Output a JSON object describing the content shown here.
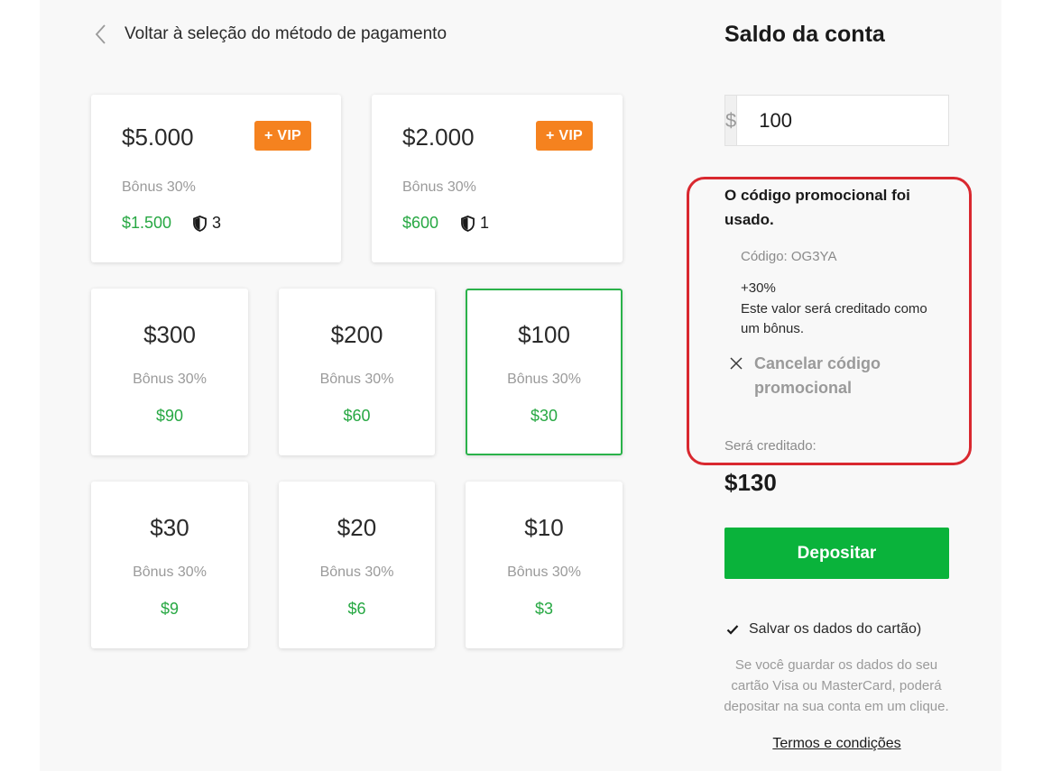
{
  "back_link": {
    "label": "Voltar à seleção do método de pagamento"
  },
  "packages_big": [
    {
      "amount": "$5.000",
      "vip_label": "+ VIP",
      "bonus_label": "Bônus 30%",
      "bonus_amount": "$1.500",
      "shield_count": "3"
    },
    {
      "amount": "$2.000",
      "vip_label": "+ VIP",
      "bonus_label": "Bônus 30%",
      "bonus_amount": "$600",
      "shield_count": "1"
    }
  ],
  "packages_small": [
    {
      "amount": "$300",
      "bonus_label": "Bônus 30%",
      "bonus_amount": "$90"
    },
    {
      "amount": "$200",
      "bonus_label": "Bônus 30%",
      "bonus_amount": "$60"
    },
    {
      "amount": "$100",
      "bonus_label": "Bônus 30%",
      "bonus_amount": "$30",
      "selected": true
    },
    {
      "amount": "$30",
      "bonus_label": "Bônus 30%",
      "bonus_amount": "$9"
    },
    {
      "amount": "$20",
      "bonus_label": "Bônus 30%",
      "bonus_amount": "$6"
    },
    {
      "amount": "$10",
      "bonus_label": "Bônus 30%",
      "bonus_amount": "$3"
    }
  ],
  "sidebar": {
    "title": "Saldo da conta",
    "currency_symbol": "$",
    "amount_value": "100",
    "promo": {
      "title": "O código promocional foi usado.",
      "code": "Código: OG3YA",
      "percent": "+30%",
      "description": "Este valor será creditado como um bônus.",
      "cancel_label": "Cancelar código promocional"
    },
    "credited_label": "Será creditado:",
    "credited_value": "$130",
    "deposit_label": "Depositar",
    "save_card_label": "Salvar os dados do cartão)",
    "save_card_checked": true,
    "save_note": "Se você guardar os dados do seu cartão Visa ou MasterCard, poderá depositar na sua conta em um clique.",
    "terms_label": "Termos e condições"
  },
  "colors": {
    "accent_green": "#0ab33b",
    "bonus_green": "#27a843",
    "vip_orange": "#f5821f",
    "highlight_red": "#d9282f"
  }
}
